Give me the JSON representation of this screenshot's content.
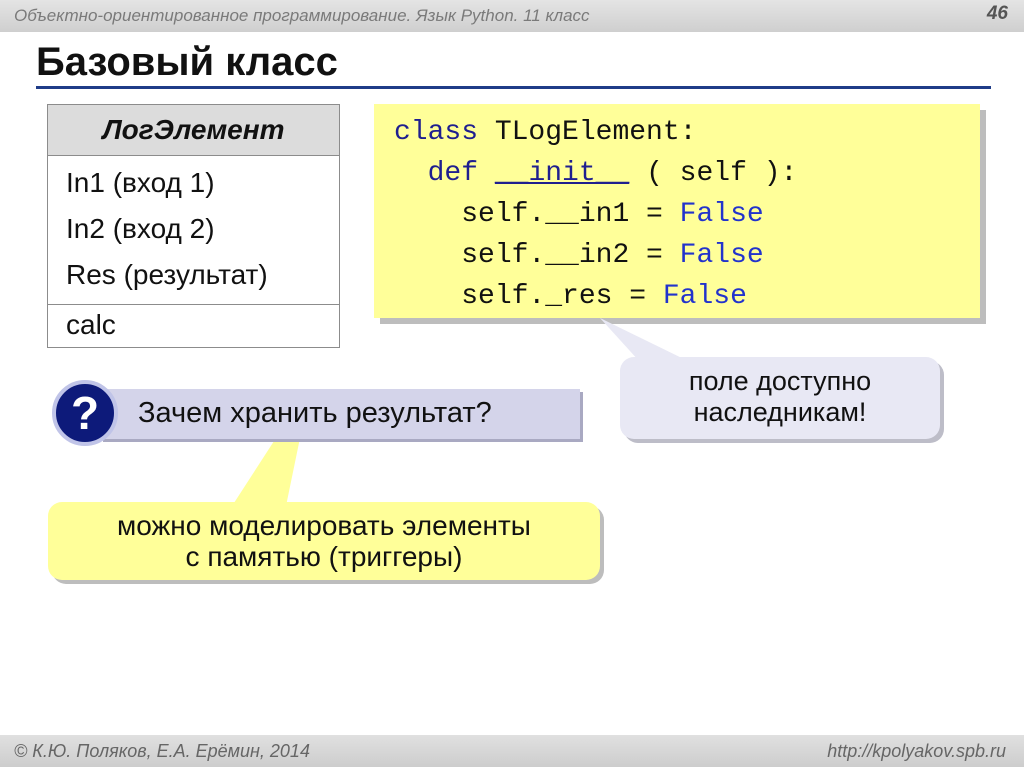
{
  "header": {
    "course": "Объектно-ориентированное программирование. Язык Python. 11 класс",
    "slide_number": "46"
  },
  "title": "Базовый класс",
  "class_table": {
    "name": "ЛогЭлемент",
    "fields": [
      "In1 (вход 1)",
      "In2 (вход 2)",
      "Res (результат)"
    ],
    "methods": [
      "calc"
    ]
  },
  "code": {
    "line1_kw": "class",
    "line1_rest": " TLogElement:",
    "line2_kw": "def",
    "line2_name": "__init__",
    "line2_rest": "( self ):",
    "line3_left": "self.__in1",
    "line4_left": "self.__in2",
    "line5_left": "self._res",
    "eq": " = ",
    "bool": "False"
  },
  "callout_inheritance": {
    "line1": "поле доступно",
    "line2": "наследникам!"
  },
  "question": {
    "mark": "?",
    "text": "Зачем хранить результат?"
  },
  "answer": {
    "line1": "можно моделировать элементы",
    "line2": "с памятью (триггеры)"
  },
  "footer": {
    "authors": "© К.Ю. Поляков, Е.А. Ерёмин, 2014",
    "site": "http://kpolyakov.spb.ru"
  },
  "colors": {
    "title_line": "#1f3c88",
    "code_bg": "#ffff99",
    "question_circle": "#0d1a7a",
    "question_bar": "#d4d4ea",
    "callout_bg": "#e8e8f4"
  }
}
